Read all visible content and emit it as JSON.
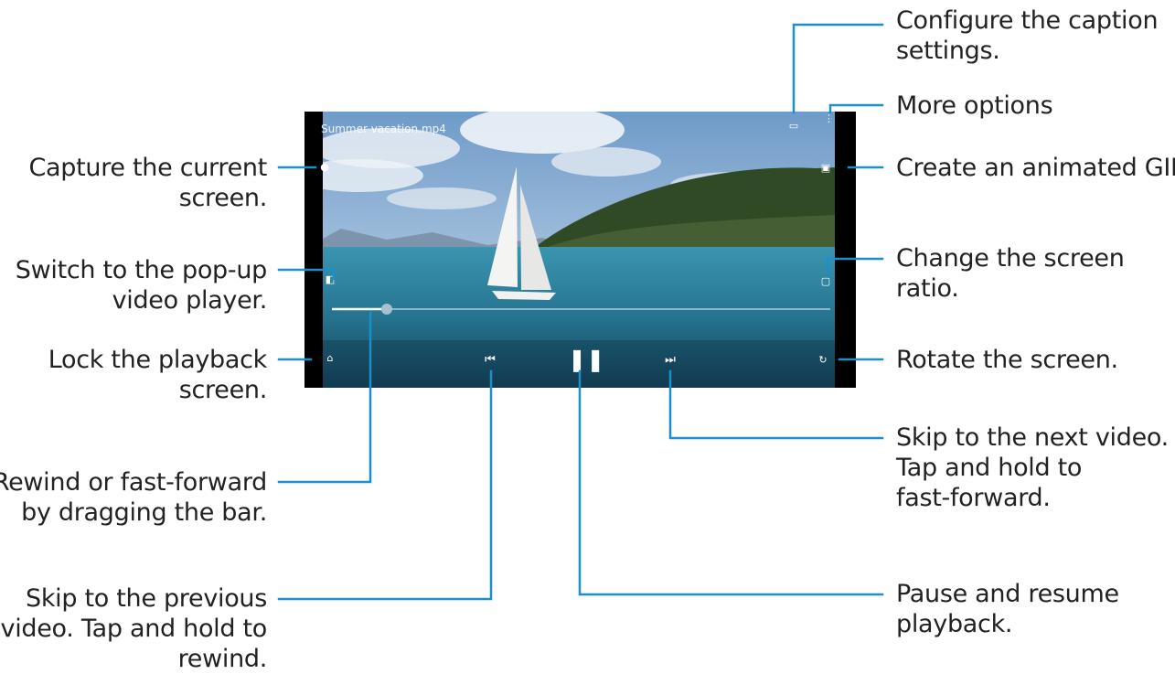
{
  "player": {
    "title": "Summer vacation.mp4",
    "progress_fraction": 0.11
  },
  "callouts": {
    "caption_settings": [
      "Configure the caption",
      "settings."
    ],
    "more_options": [
      "More options"
    ],
    "animated_gif": [
      "Create an animated GIF."
    ],
    "screen_ratio": [
      "Change the screen",
      "ratio."
    ],
    "rotate": [
      "Rotate the screen."
    ],
    "next_video": [
      "Skip to the next video.",
      "Tap and hold to",
      "fast-forward."
    ],
    "pause_resume": [
      "Pause and resume",
      "playback."
    ],
    "capture": [
      "Capture the current",
      "screen."
    ],
    "popup_player": [
      "Switch to the pop-up",
      "video player."
    ],
    "lock": [
      "Lock the playback",
      "screen."
    ],
    "seek_bar": [
      "Rewind or fast-forward",
      "by dragging the bar."
    ],
    "previous_video": [
      "Skip to the previous",
      "video. Tap and hold to",
      "rewind."
    ]
  },
  "colors": {
    "leader_line": "#1a8fc9",
    "sea": "#2a7f9e",
    "sky": "#7fa6cf"
  },
  "icons": [
    "caption-icon",
    "more-options-icon",
    "gif-icon",
    "screen-ratio-icon",
    "rotate-icon",
    "next-icon",
    "pause-icon",
    "previous-icon",
    "capture-icon",
    "popup-player-icon",
    "lock-icon"
  ]
}
